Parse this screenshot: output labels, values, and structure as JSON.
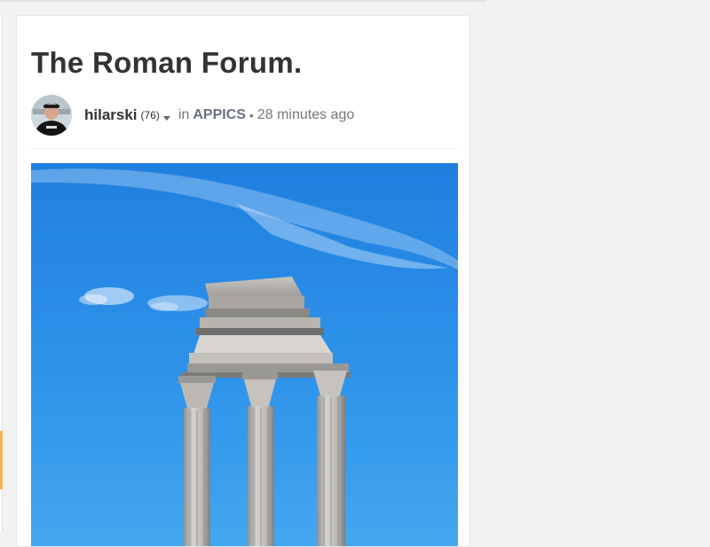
{
  "post": {
    "title": "The Roman Forum.",
    "author": "hilarski",
    "reputation": "(76)",
    "in_label": "in",
    "community": "APPICS",
    "separator": "•",
    "time_ago": "28 minutes ago"
  },
  "icons": {
    "menu_caret": "caret-down-icon",
    "avatar": "user-avatar",
    "image": "roman-forum-columns-photo"
  },
  "colors": {
    "page_background": "#f2f2f2",
    "card_background": "#ffffff",
    "title_text": "#333333",
    "meta_text": "#777777",
    "community_text": "#6b7280",
    "sky_blue": "#2f8ae3",
    "left_accent": "#f6b352"
  }
}
